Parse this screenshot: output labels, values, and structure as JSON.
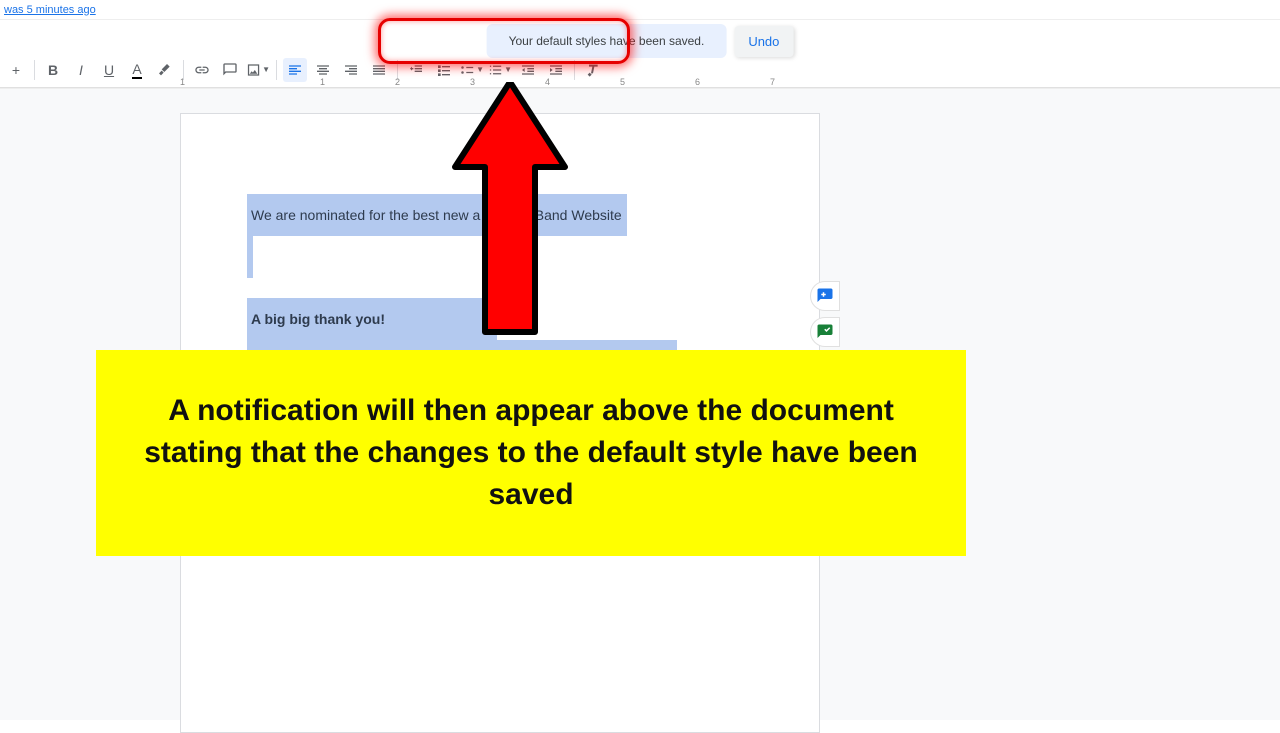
{
  "header": {
    "history_text": "was 5 minutes ago"
  },
  "notification": {
    "message": "Your default styles have been saved.",
    "undo_label": "Undo"
  },
  "toolbar": {
    "bold": "B",
    "italic": "I",
    "underline": "U",
    "textcolor": "A"
  },
  "ruler": {
    "ticks": [
      "1",
      "1",
      "2",
      "3",
      "4",
      "5",
      "6",
      "7"
    ]
  },
  "document": {
    "line1": "We are nominated for the best new a              Band Website",
    "line3": "A big big thank you!"
  },
  "caption": {
    "text": "A notification will then appear above the document stating that the changes to the default style have been saved"
  }
}
